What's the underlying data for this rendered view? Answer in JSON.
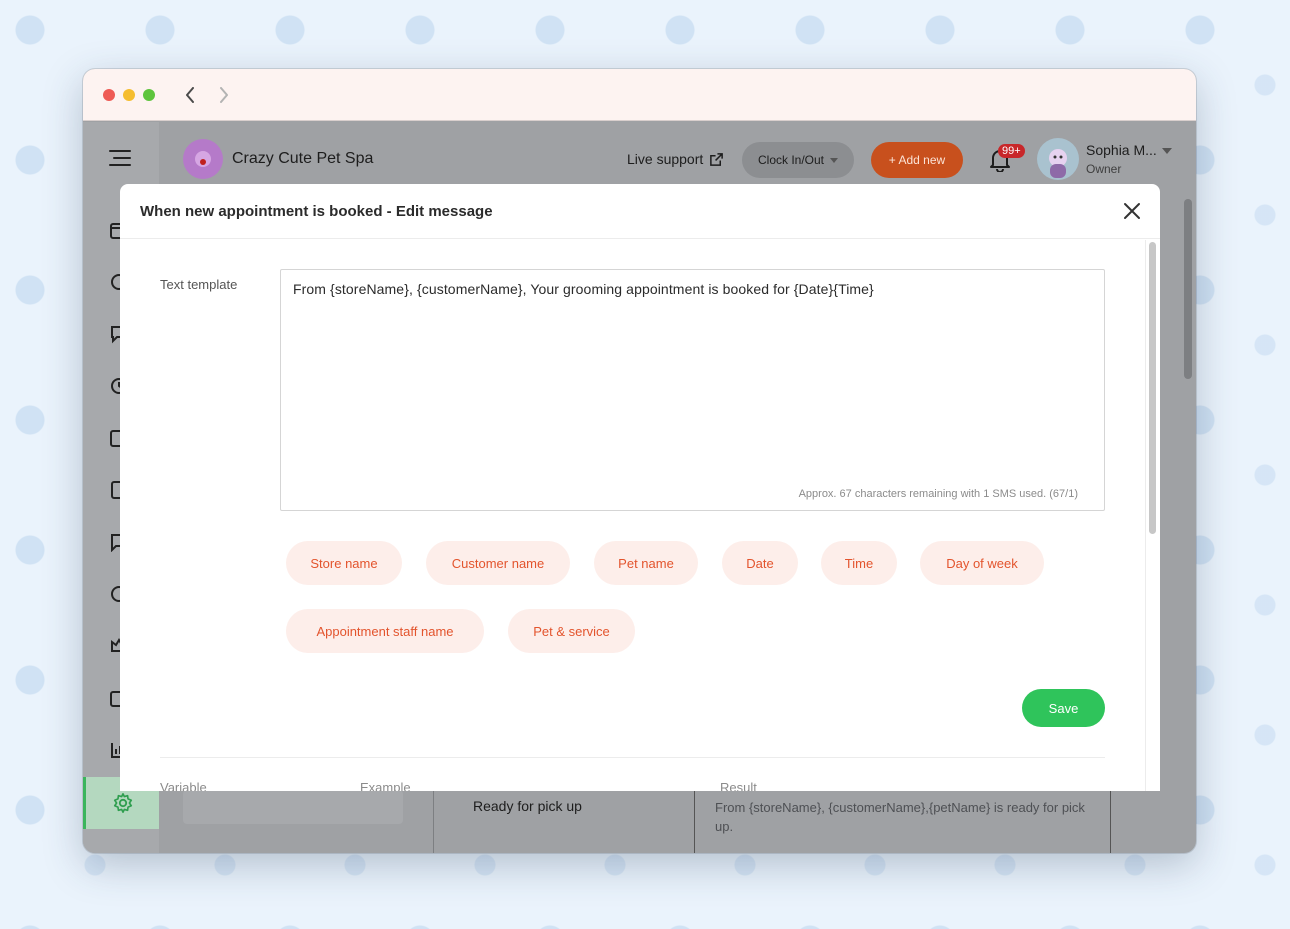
{
  "app": {
    "store_name": "Crazy Cute Pet Spa",
    "live_support": "Live support",
    "clock_label": "Clock In/Out",
    "add_new_label": "+ Add new",
    "notification_count": "99+",
    "user_name": "Sophia M...",
    "user_role": "Owner",
    "accent_color": "#3ab55c",
    "brand_color": "#e3542d"
  },
  "background_table": {
    "status": "Ready for pick up",
    "result": "From {storeName}, {customerName},{petName} is ready for pick up."
  },
  "modal": {
    "title": "When new appointment is booked - Edit message",
    "template_label": "Text template",
    "template_text": "From {storeName}, {customerName}, Your grooming appointment is booked for {Date}{Time}",
    "char_count": "Approx. 67 characters remaining with 1 SMS used. (67/1)",
    "variables": [
      "Store name",
      "Customer name",
      "Pet name",
      "Date",
      "Time",
      "Day of week",
      "Appointment staff name",
      "Pet & service"
    ],
    "save_label": "Save",
    "columns": [
      "Variable",
      "Example",
      "Result"
    ]
  }
}
